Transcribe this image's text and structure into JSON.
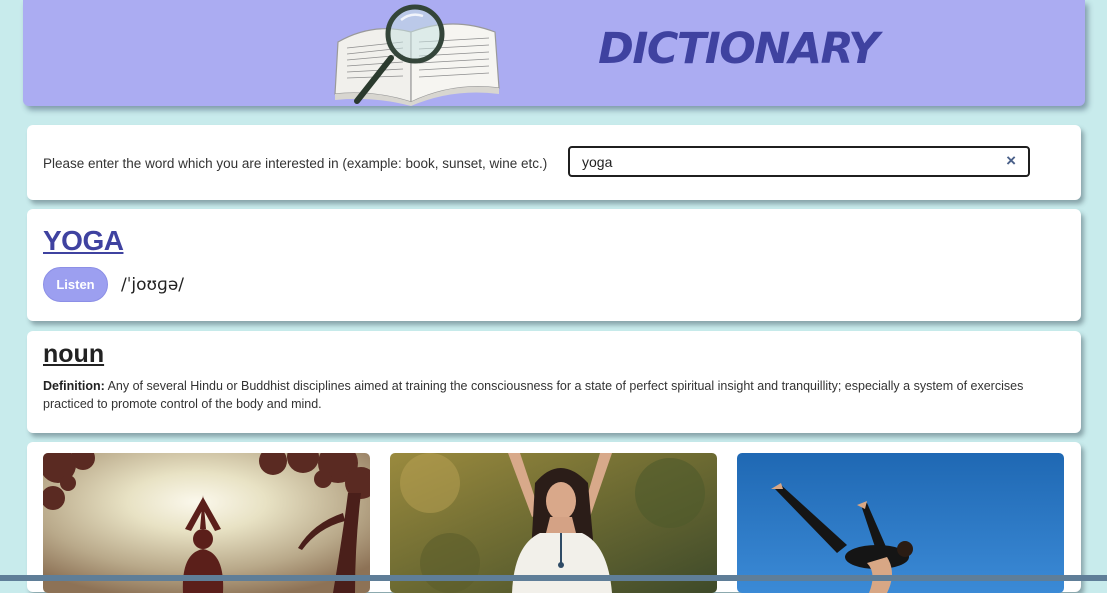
{
  "header": {
    "title": "DICTIONARY",
    "logo_icon": "book-magnifier-icon"
  },
  "search": {
    "prompt": "Please enter the word which you are interested in (example: book, sunset, wine etc.)",
    "value": "yoga",
    "clear_symbol": "×"
  },
  "word": {
    "title": "YOGA",
    "listen_label": "Listen",
    "phonetic": "/ˈjoʊɡə/"
  },
  "meaning": {
    "part_of_speech": "noun",
    "definition_label": "Definition:",
    "definition_text": "Any of several Hindu or Buddhist disciplines aimed at training the consciousness for a state of perfect spiritual insight and tranquillity; especially a system of exercises practiced to promote control of the body and mind."
  },
  "colors": {
    "header_bg": "#abacf2",
    "title": "#3f42a0",
    "page_bg": "#c8ebec",
    "button": "#9c9ff0"
  }
}
